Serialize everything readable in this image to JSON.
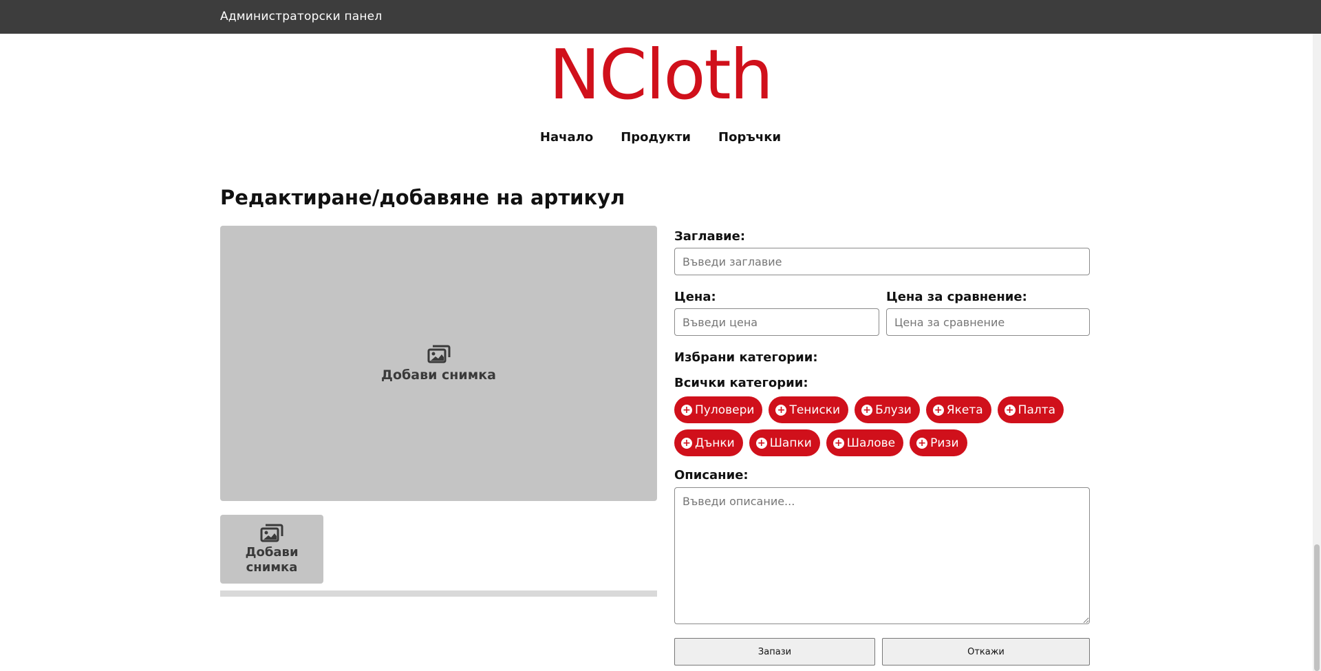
{
  "topbar": {
    "title": "Администраторски панел"
  },
  "logo": {
    "text": "NCloth"
  },
  "nav": {
    "items": [
      "Начало",
      "Продукти",
      "Поръчки"
    ]
  },
  "page": {
    "title": "Редактиране/добавяне на артикул"
  },
  "image_area": {
    "main_label": "Добави снимка",
    "thumb_label": "Добави снимка",
    "icon": "images-icon"
  },
  "form": {
    "title_label": "Заглавие:",
    "title_placeholder": "Въведи заглавие",
    "price_label": "Цена:",
    "price_placeholder": "Въведи цена",
    "compare_label": "Цена за сравнение:",
    "compare_placeholder": "Цена за сравнение",
    "selected_categories_label": "Избрани категории:",
    "all_categories_label": "Всички категории:",
    "categories": [
      "Пуловери",
      "Тениски",
      "Блузи",
      "Якета",
      "Палта",
      "Дънки",
      "Шапки",
      "Шалове",
      "Ризи"
    ],
    "description_label": "Описание:",
    "description_placeholder": "Въведи описание..."
  },
  "actions": {
    "save_label": "Запази",
    "cancel_label": "Откажи"
  },
  "colors": {
    "brand": "#d0101b",
    "topbar": "#3d3d3d",
    "image_bg": "#c4c4c4"
  }
}
